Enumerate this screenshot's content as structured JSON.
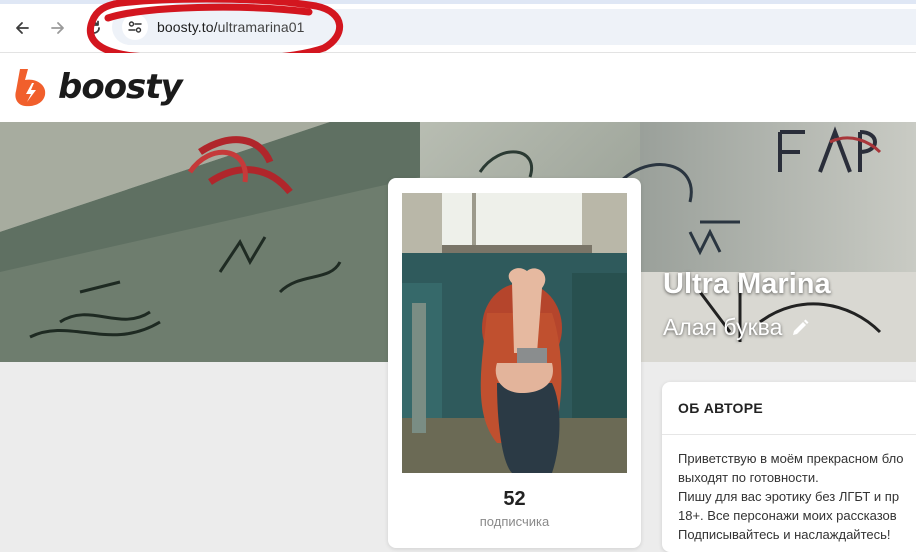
{
  "browser": {
    "url_host": "boosty.to/",
    "url_path": "ultramarina01",
    "icons": [
      "back-arrow-icon",
      "forward-arrow-icon",
      "reload-icon",
      "site-info-icon"
    ]
  },
  "site": {
    "logo_text": "boosty",
    "brand_color": "#f15f2c"
  },
  "creator": {
    "name": "Ultra Marina",
    "subtitle": "Алая буква"
  },
  "stats": {
    "subscribers_count": "52",
    "subscribers_label": "подписчика"
  },
  "about": {
    "title": "ОБ АВТОРЕ",
    "lines": [
      "Приветствую в моём прекрасном бло",
      "выходят по готовности.",
      "Пишу для вас эротику без ЛГБТ и пр",
      "18+. Все персонажи моих рассказов",
      "Подписывайтесь и наслаждайтесь!"
    ]
  }
}
